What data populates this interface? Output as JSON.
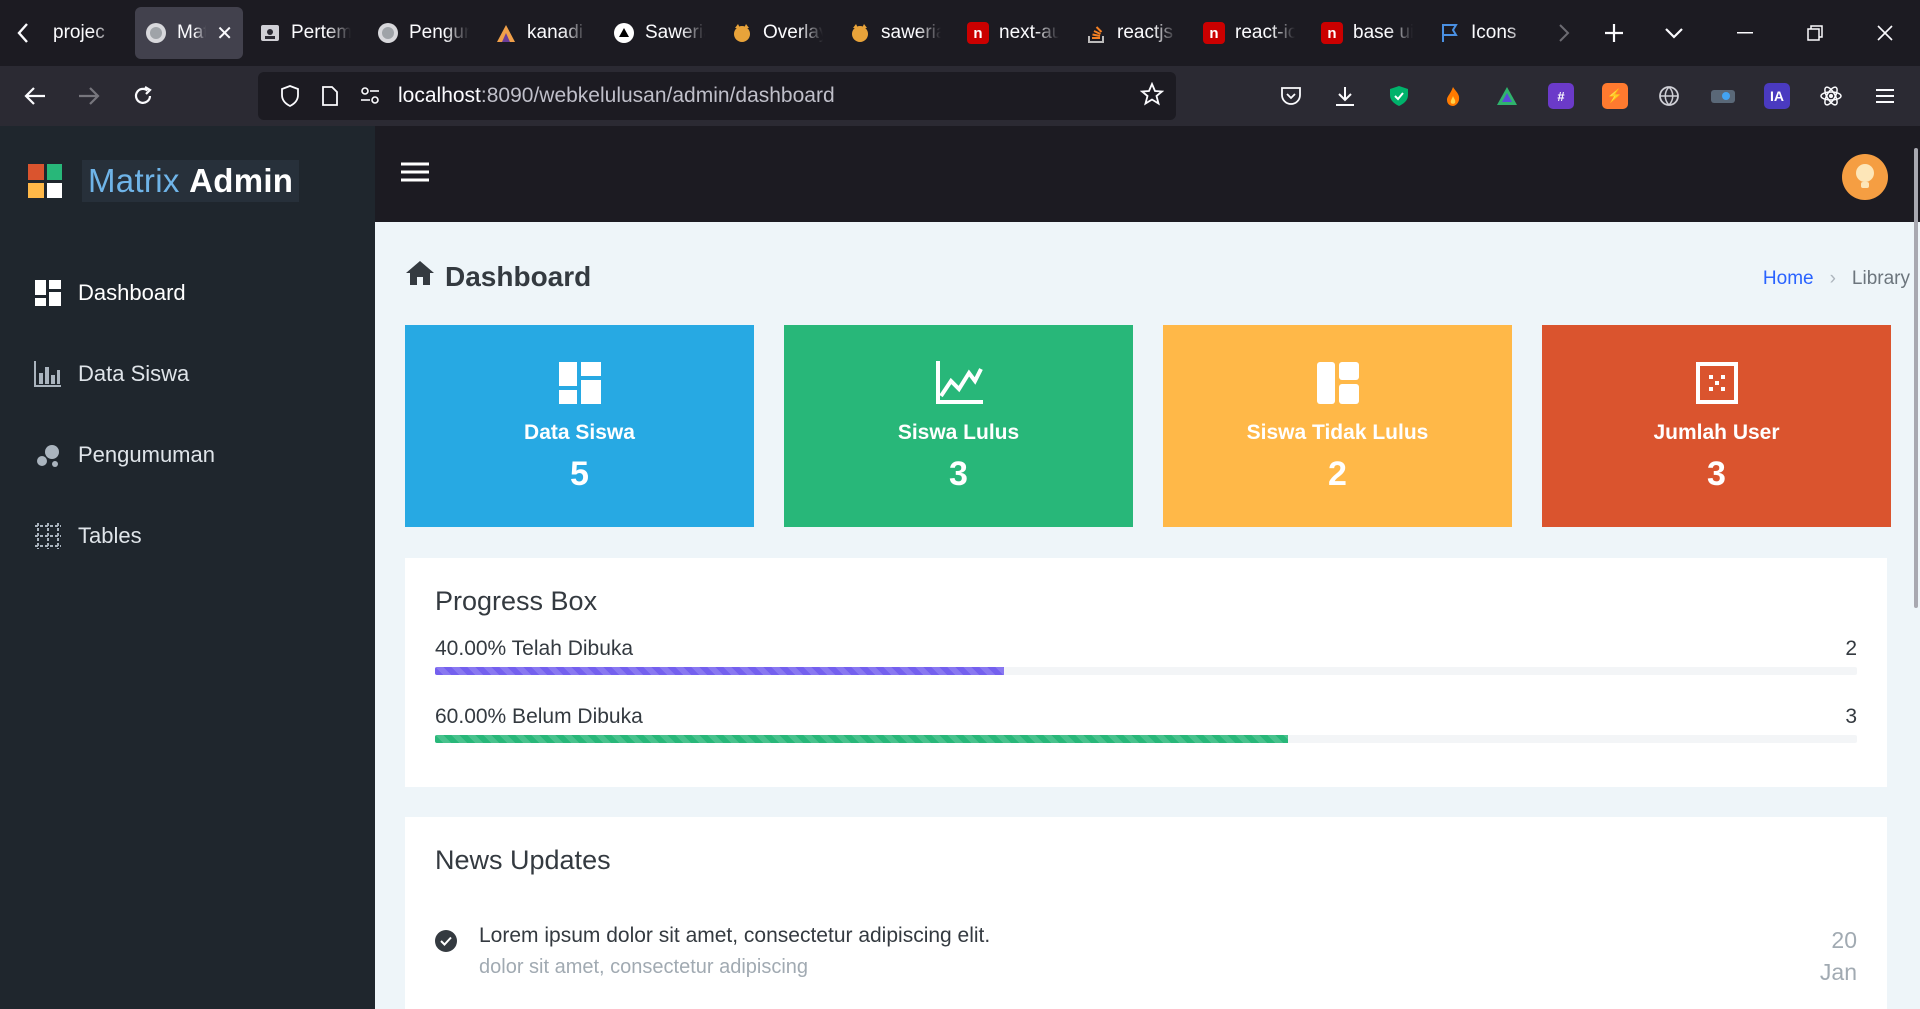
{
  "browser": {
    "tabs": [
      {
        "title": "projec",
        "icon": "generic"
      },
      {
        "title": "Matrix Admin",
        "icon": "school-seal",
        "active": true
      },
      {
        "title": "Pertemuan",
        "icon": "classroom"
      },
      {
        "title": "Pengumuman",
        "icon": "school-seal"
      },
      {
        "title": "kanadi",
        "icon": "mountain"
      },
      {
        "title": "Saweria",
        "icon": "triangle"
      },
      {
        "title": "Overlay",
        "icon": "cat"
      },
      {
        "title": "saweria",
        "icon": "cat"
      },
      {
        "title": "next-auth",
        "icon": "npm"
      },
      {
        "title": "reactjs",
        "icon": "stackoverflow"
      },
      {
        "title": "react-icons",
        "icon": "npm"
      },
      {
        "title": "base ui",
        "icon": "npm"
      },
      {
        "title": "Icons",
        "icon": "flag"
      }
    ],
    "url_host": "localhost",
    "url_path": ":8090/webkelulusan/admin/dashboard"
  },
  "sidebar": {
    "brand_part1": "Matrix",
    "brand_part2": "Admin",
    "items": [
      {
        "label": "Dashboard",
        "icon": "dashboard-icon"
      },
      {
        "label": "Data Siswa",
        "icon": "bar-chart-icon"
      },
      {
        "label": "Pengumuman",
        "icon": "bubbles-icon"
      },
      {
        "label": "Tables",
        "icon": "table-icon"
      }
    ]
  },
  "header": {
    "title": "Dashboard",
    "breadcrumb_home": "Home",
    "breadcrumb_current": "Library"
  },
  "cards": [
    {
      "label": "Data Siswa",
      "value": "5",
      "color": "#27a9e3",
      "icon": "dashboard-icon"
    },
    {
      "label": "Siswa Lulus",
      "value": "3",
      "color": "#28b779",
      "icon": "chart-line-icon"
    },
    {
      "label": "Siswa Tidak Lulus",
      "value": "2",
      "color": "#ffb848",
      "icon": "layout-icon"
    },
    {
      "label": "Jumlah User",
      "value": "3",
      "color": "#da542e",
      "icon": "grid-dots-icon"
    }
  ],
  "progress_box": {
    "title": "Progress Box",
    "items": [
      {
        "label": "40.00% Telah Dibuka",
        "count": "2",
        "percent": 40,
        "color": "#7460ee"
      },
      {
        "label": "60.00% Belum Dibuka",
        "count": "3",
        "percent": 60,
        "color": "#28b779"
      }
    ]
  },
  "news": {
    "title": "News Updates",
    "items": [
      {
        "title": "Lorem ipsum dolor sit amet, consectetur adipiscing elit.",
        "subtitle": "dolor sit amet, consectetur adipiscing",
        "day": "20",
        "month": "Jan"
      }
    ]
  }
}
